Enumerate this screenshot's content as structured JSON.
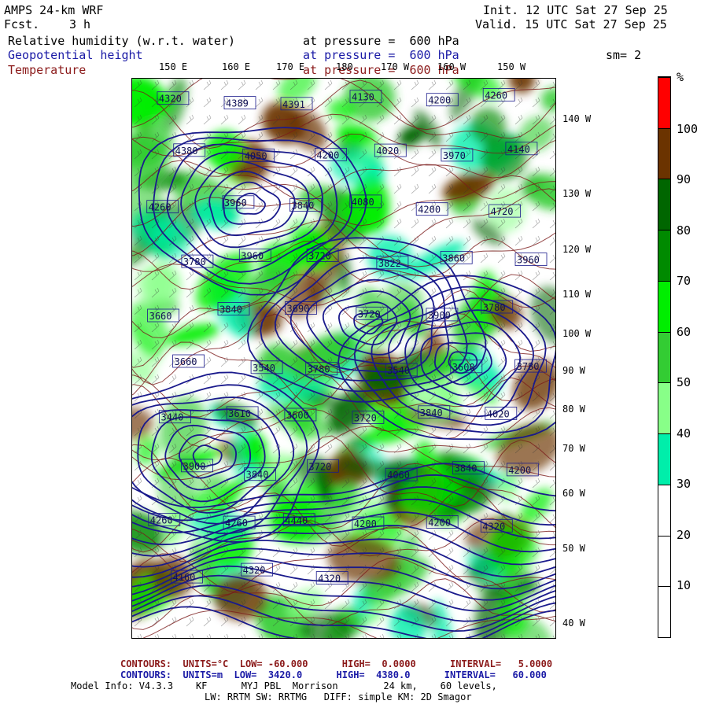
{
  "header": {
    "model": "AMPS 24-km WRF",
    "fcst_label": "Fcst.",
    "fcst_value": "3 h",
    "init": "Init. 12 UTC Sat 27 Sep 25",
    "valid": "Valid. 15 UTC Sat 27 Sep 25",
    "field1_name": "Relative humidity (w.r.t. water)",
    "field2_name": "Geopotential height",
    "field3_name": "Temperature",
    "level_text": "at pressure =  600 hPa",
    "smoothing": "sm= 2"
  },
  "colors": {
    "blue_text": "#1a1aa6",
    "red_text": "#8b1a1a",
    "height_contour": "#1a1a8c",
    "temp_contour": "#7a1a1a"
  },
  "lon_labels": [
    "150 E",
    "160 E",
    "170 E",
    "180",
    "170 W",
    "160 W",
    "150 W"
  ],
  "lat_labels": [
    "140 W",
    "130 W",
    "120 W",
    "110 W",
    "100 W",
    "90 W",
    "80 W",
    "70 W",
    "60 W",
    "50 W",
    "40 W"
  ],
  "height_labels": [
    "4320",
    "4389",
    "4391",
    "4130",
    "4200",
    "4260",
    "4380",
    "4050",
    "4200",
    "4020",
    "3970",
    "4140",
    "4260",
    "3960",
    "3840",
    "4080",
    "4200",
    "4720",
    "3780",
    "3960",
    "3720",
    "3822",
    "3860",
    "3960",
    "3660",
    "3840",
    "3690",
    "3720",
    "3900",
    "3780",
    "3660",
    "3540",
    "3780",
    "3540",
    "3600",
    "3780",
    "3440",
    "3610",
    "3600",
    "3720",
    "3840",
    "4020",
    "3900",
    "3840",
    "3720",
    "4060",
    "3840",
    "4200",
    "4260",
    "4260",
    "4440",
    "4200",
    "4200",
    "4320",
    "4160",
    "4320",
    "4320"
  ],
  "colorbar": {
    "unit": "%",
    "labels": [
      "100",
      "90",
      "80",
      "70",
      "60",
      "50",
      "40",
      "30",
      "20",
      "10"
    ],
    "segments": [
      {
        "color": "#ff0000"
      },
      {
        "color": "#6b3300"
      },
      {
        "color": "#006600"
      },
      {
        "color": "#008a00"
      },
      {
        "color": "#00ee00"
      },
      {
        "color": "#33cc33"
      },
      {
        "color": "#88ff88"
      },
      {
        "color": "#00eeaa"
      },
      {
        "color": "#ffffff"
      },
      {
        "color": "#ffffff"
      },
      {
        "color": "#ffffff"
      }
    ]
  },
  "footer": {
    "temp_contours": "CONTOURS:  UNITS=°C  LOW= -60.000      HIGH=  0.0000      INTERVAL=   5.0000",
    "height_contours": "CONTOURS:  UNITS=m  LOW=  3420.0      HIGH=  4380.0      INTERVAL=   60.000",
    "model_info_1": "Model Info: V4.3.3    KF      MYJ PBL  Morrison        24 km,    60 levels,",
    "model_info_2": "LW: RRTM SW: RRTMG   DIFF: simple KM: 2D Smagor"
  }
}
